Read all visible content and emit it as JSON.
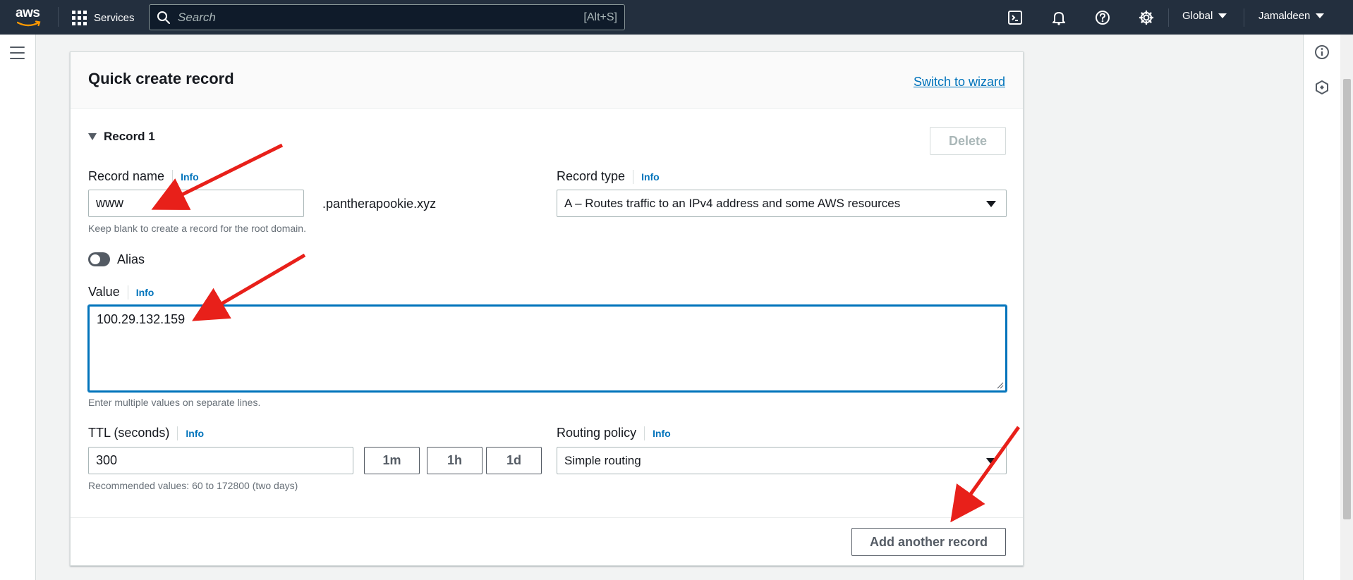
{
  "topnav": {
    "logo_text": "aws",
    "services_label": "Services",
    "search_placeholder": "Search",
    "search_shortcut": "[Alt+S]",
    "region_label": "Global",
    "account_label": "Jamaldeen"
  },
  "panel": {
    "title": "Quick create record",
    "switch_link": "Switch to wizard"
  },
  "record": {
    "section_label": "Record 1",
    "delete_label": "Delete",
    "record_name": {
      "label": "Record name",
      "info": "Info",
      "value": "www",
      "suffix": ".pantherapookie.xyz",
      "help": "Keep blank to create a record for the root domain."
    },
    "record_type": {
      "label": "Record type",
      "info": "Info",
      "value": "A – Routes traffic to an IPv4 address and some AWS resources"
    },
    "alias": {
      "label": "Alias",
      "enabled": false
    },
    "value": {
      "label": "Value",
      "info": "Info",
      "text": "100.29.132.159",
      "help": "Enter multiple values on separate lines."
    },
    "ttl": {
      "label": "TTL (seconds)",
      "info": "Info",
      "value": "300",
      "presets": [
        "1m",
        "1h",
        "1d"
      ],
      "help": "Recommended values: 60 to 172800 (two days)"
    },
    "routing_policy": {
      "label": "Routing policy",
      "info": "Info",
      "value": "Simple routing"
    }
  },
  "footer": {
    "add_label": "Add another record"
  },
  "colors": {
    "nav_bg": "#232f3e",
    "link": "#0073bb",
    "focus": "#0073bb",
    "annotation_arrow": "#e8201a"
  }
}
